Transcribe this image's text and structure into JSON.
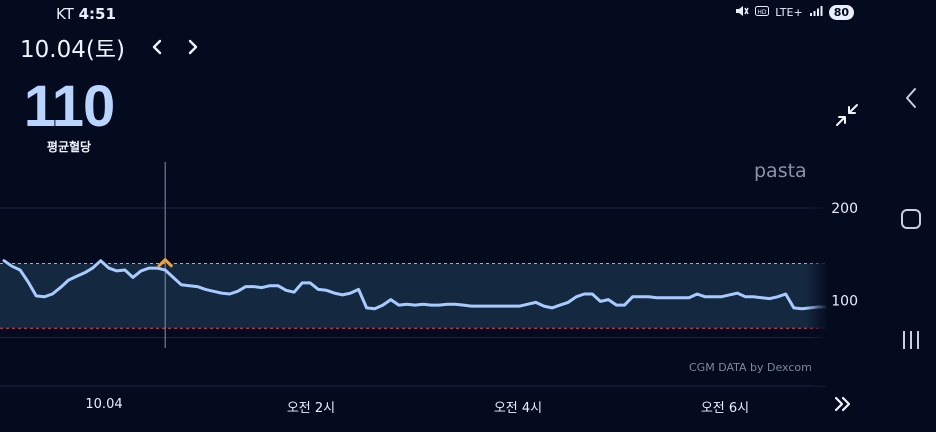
{
  "status_bar": {
    "carrier": "KT",
    "time": "4:51",
    "network": "LTE+",
    "battery": "80"
  },
  "header": {
    "date": "10.04(토)"
  },
  "summary": {
    "value": "110",
    "label": "평균혈당"
  },
  "brand": "pasta",
  "credit": "CGM DATA by Dexcom",
  "colors": {
    "background": "#050b1f",
    "line": "#a8cbff",
    "target_band": "#14283f",
    "high_threshold": "#f2a13a",
    "low_threshold": "#e0475a",
    "marker": "#f2a13a"
  },
  "icons": {
    "prev": "chevron-left-icon",
    "next": "chevron-right-icon",
    "collapse": "collapse-icon",
    "more": "double-chevron-right-icon",
    "mute": "mute-icon",
    "signal": "signal-icon"
  },
  "chart_data": {
    "type": "line",
    "y_tick_labels": [
      "200",
      "100"
    ],
    "x_tick_labels": [
      "10.04",
      "오전 2시",
      "오전 4시",
      "오전 6시"
    ],
    "ylim": [
      40,
      260
    ],
    "target_range": [
      70,
      140
    ],
    "grid": true,
    "x": [
      0,
      1,
      2,
      3,
      4,
      5,
      6,
      7,
      8,
      9,
      10,
      11,
      12,
      13,
      14,
      15,
      16,
      17,
      18,
      19,
      20,
      21,
      22,
      23,
      24,
      25,
      26,
      27,
      28,
      29,
      30,
      31,
      32,
      33,
      34,
      35,
      36,
      37,
      38,
      39,
      40,
      41,
      42,
      43,
      44,
      45,
      46,
      47,
      48,
      49,
      50,
      51,
      52,
      53,
      54,
      55,
      56,
      57,
      58,
      59,
      60,
      61,
      62,
      63,
      64,
      65,
      66,
      67,
      68,
      69,
      70,
      71,
      72,
      73,
      74,
      75,
      76,
      77,
      78,
      79,
      80,
      81,
      82,
      83,
      84,
      85,
      86,
      87,
      88,
      89,
      90,
      91,
      92,
      93,
      94,
      95,
      96,
      97,
      98,
      99,
      100,
      101,
      102,
      103,
      104,
      105,
      106,
      107,
      108,
      109,
      110,
      111,
      112,
      113,
      114,
      115,
      116,
      117,
      118,
      119,
      120,
      121,
      122,
      123,
      124,
      125,
      126,
      127,
      128,
      129,
      130,
      131,
      132,
      133,
      134,
      135,
      136,
      137,
      138,
      139,
      140,
      141,
      142,
      143,
      144,
      145,
      146,
      147,
      148,
      149,
      150,
      151,
      152,
      153,
      154,
      155,
      156,
      157,
      158,
      159,
      160,
      161,
      162,
      163,
      164,
      165,
      166
    ],
    "values": [
      143,
      137,
      133,
      120,
      105,
      104,
      107,
      114,
      122,
      126,
      130,
      135,
      143,
      135,
      132,
      133,
      125,
      132,
      135,
      135,
      133,
      125,
      117,
      116,
      115,
      112,
      110,
      108,
      107,
      110,
      115,
      115,
      114,
      116,
      116,
      111,
      109,
      119,
      119,
      112,
      111,
      108,
      106,
      108,
      112,
      92,
      91,
      95,
      101,
      95,
      96,
      95,
      96,
      95,
      95,
      96,
      96,
      95,
      94,
      94,
      94,
      94,
      94,
      94,
      94,
      96,
      98,
      94,
      92,
      95,
      98,
      104,
      107,
      107,
      99,
      101,
      95,
      95,
      104,
      104,
      104,
      103,
      103,
      103,
      103,
      103,
      107,
      104,
      104,
      104,
      106,
      108,
      104,
      104,
      103,
      102,
      104,
      107,
      92,
      91,
      92,
      93,
      93
    ],
    "highlight_x": 20,
    "highlight_value": 143
  }
}
